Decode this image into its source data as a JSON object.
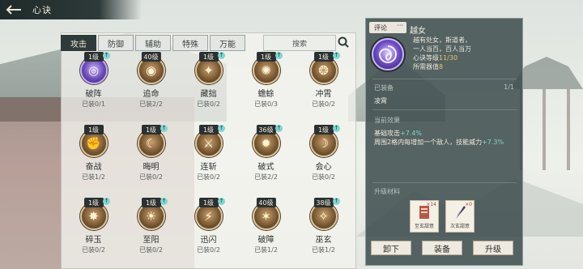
{
  "header": {
    "back_icon": "back-arrow-icon",
    "title": "心诀"
  },
  "tabs": [
    {
      "label": "攻击",
      "active": true
    },
    {
      "label": "防御",
      "active": false
    },
    {
      "label": "辅助",
      "active": false
    },
    {
      "label": "特殊",
      "active": false
    },
    {
      "label": "万能",
      "active": false
    }
  ],
  "search": {
    "placeholder": "搜索",
    "icon": "search-icon"
  },
  "skills": [
    {
      "name": "破阵",
      "level": "1级",
      "equip": "已装0/1",
      "icon": "vortex-icon",
      "purple": true,
      "upgradable": true
    },
    {
      "name": "追命",
      "level": "40级",
      "equip": "已装2/2",
      "icon": "swirl-icon",
      "purple": false,
      "upgradable": false
    },
    {
      "name": "藏拙",
      "level": "1级",
      "equip": "已装0/2",
      "icon": "claw-icon",
      "purple": false,
      "upgradable": true
    },
    {
      "name": "蟾蜍",
      "level": "1级",
      "equip": "已装0/3",
      "icon": "toad-icon",
      "purple": false,
      "upgradable": true
    },
    {
      "name": "冲霄",
      "level": "1级",
      "equip": "已装0/2",
      "icon": "spiral-icon",
      "purple": false,
      "upgradable": true
    },
    {
      "name": "奋战",
      "level": "1级",
      "equip": "已装1/2",
      "icon": "fist-icon",
      "purple": false,
      "upgradable": false
    },
    {
      "name": "晦明",
      "level": "1级",
      "equip": "已装0/2",
      "icon": "moon-icon",
      "purple": false,
      "upgradable": true
    },
    {
      "name": "连斩",
      "level": "1级",
      "equip": "已装0/2",
      "icon": "blade-icon",
      "purple": false,
      "upgradable": true
    },
    {
      "name": "破式",
      "level": "36级",
      "equip": "已装2/2",
      "icon": "burst-icon",
      "purple": false,
      "upgradable": true
    },
    {
      "name": "会心",
      "level": "1级",
      "equip": "已装0/2",
      "icon": "crescent-icon",
      "purple": false,
      "upgradable": true
    },
    {
      "name": "碎玉",
      "level": "1级",
      "equip": "已装0/2",
      "icon": "shatter-icon",
      "purple": false,
      "upgradable": true
    },
    {
      "name": "至阳",
      "level": "1级",
      "equip": "已装0/2",
      "icon": "sun-icon",
      "purple": false,
      "upgradable": true
    },
    {
      "name": "迅闪",
      "level": "1级",
      "equip": "已装0/2",
      "icon": "flash-icon",
      "purple": false,
      "upgradable": true
    },
    {
      "name": "破障",
      "level": "40级",
      "equip": "已装1/2",
      "icon": "break-icon",
      "purple": false,
      "upgradable": false
    },
    {
      "name": "巫玄",
      "level": "38级",
      "equip": "已装1/2",
      "icon": "rune-icon",
      "purple": false,
      "upgradable": true
    }
  ],
  "detail": {
    "review_label": "评论",
    "review_more": "···",
    "title": "越女",
    "desc_lines": [
      "越有处女，斯道者，",
      "一人当百，百人当万"
    ],
    "level_label": "心诀等级",
    "level_value": "11/30",
    "cost_label": "所需器值",
    "cost_value": "8",
    "equipped_label": "已装备",
    "equipped_count": "1/1",
    "equipped_value": "凌霄",
    "effect_label": "当前效果",
    "effect_line1_prefix": "基础攻击",
    "effect_line1_value": "+7.4%",
    "effect_line2_prefix": "周围2格内每增加一个敌人，技能威力",
    "effect_line2_value": "+7.3%",
    "materials_label": "升级材料",
    "materials": [
      {
        "name": "至玄甜意",
        "count": "×14",
        "icon": "scroll-icon"
      },
      {
        "name": "次玄甜意",
        "count": "×0",
        "icon": "quill-icon"
      }
    ],
    "buttons": {
      "unequip": "卸下",
      "equip": "装备",
      "upgrade": "升级"
    }
  }
}
